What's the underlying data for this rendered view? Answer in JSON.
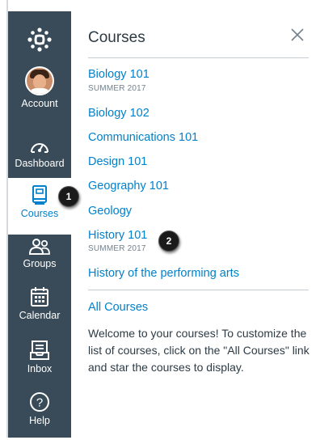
{
  "nav": {
    "items": [
      {
        "label": "Account",
        "icon": "avatar"
      },
      {
        "label": "Dashboard",
        "icon": "dashboard-icon"
      },
      {
        "label": "Courses",
        "icon": "courses-icon",
        "active": true
      },
      {
        "label": "Groups",
        "icon": "groups-icon"
      },
      {
        "label": "Calendar",
        "icon": "calendar-icon"
      },
      {
        "label": "Inbox",
        "icon": "inbox-icon"
      },
      {
        "label": "Help",
        "icon": "help-icon"
      }
    ]
  },
  "tray": {
    "title": "Courses",
    "courses": [
      {
        "name": "Biology 101",
        "term": "SUMMER 2017"
      },
      {
        "name": "Biology 102"
      },
      {
        "name": "Communications 101"
      },
      {
        "name": "Design 101"
      },
      {
        "name": "Geography 101"
      },
      {
        "name": "Geology"
      },
      {
        "name": "History 101",
        "term": "SUMMER 2017"
      },
      {
        "name": "History of the performing arts"
      }
    ],
    "all_courses_label": "All Courses",
    "welcome_text": "Welcome to your courses! To customize the list of courses, click on the \"All Courses\" link and star the courses to display."
  },
  "callouts": [
    "1",
    "2"
  ],
  "colors": {
    "nav_bg": "#394b58",
    "link": "#0081cc",
    "text": "#2d3b45",
    "muted": "#73818c",
    "callout": "#1a1a1a"
  }
}
